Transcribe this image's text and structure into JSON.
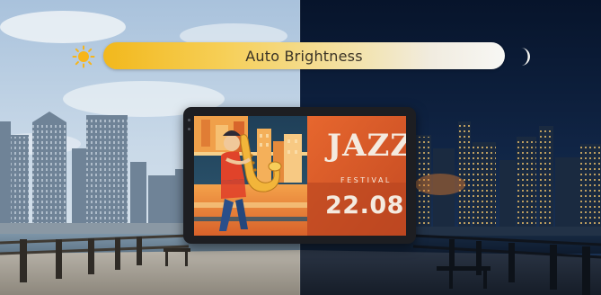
{
  "slider": {
    "label": "Auto Brightness",
    "left_icon": "sun-icon",
    "right_icon": "moon-icon",
    "colors": {
      "start": "#f2b81c",
      "end": "#f7f7f4"
    }
  },
  "poster": {
    "title": "JAZZ",
    "subtitle": "FESTIVAL",
    "date": "22.08"
  },
  "scene": {
    "left_mode": "day",
    "right_mode": "night",
    "colors": {
      "day_sky": "#b9cde3",
      "night_sky": "#0b1a33",
      "sun": "#f7b51a"
    }
  }
}
